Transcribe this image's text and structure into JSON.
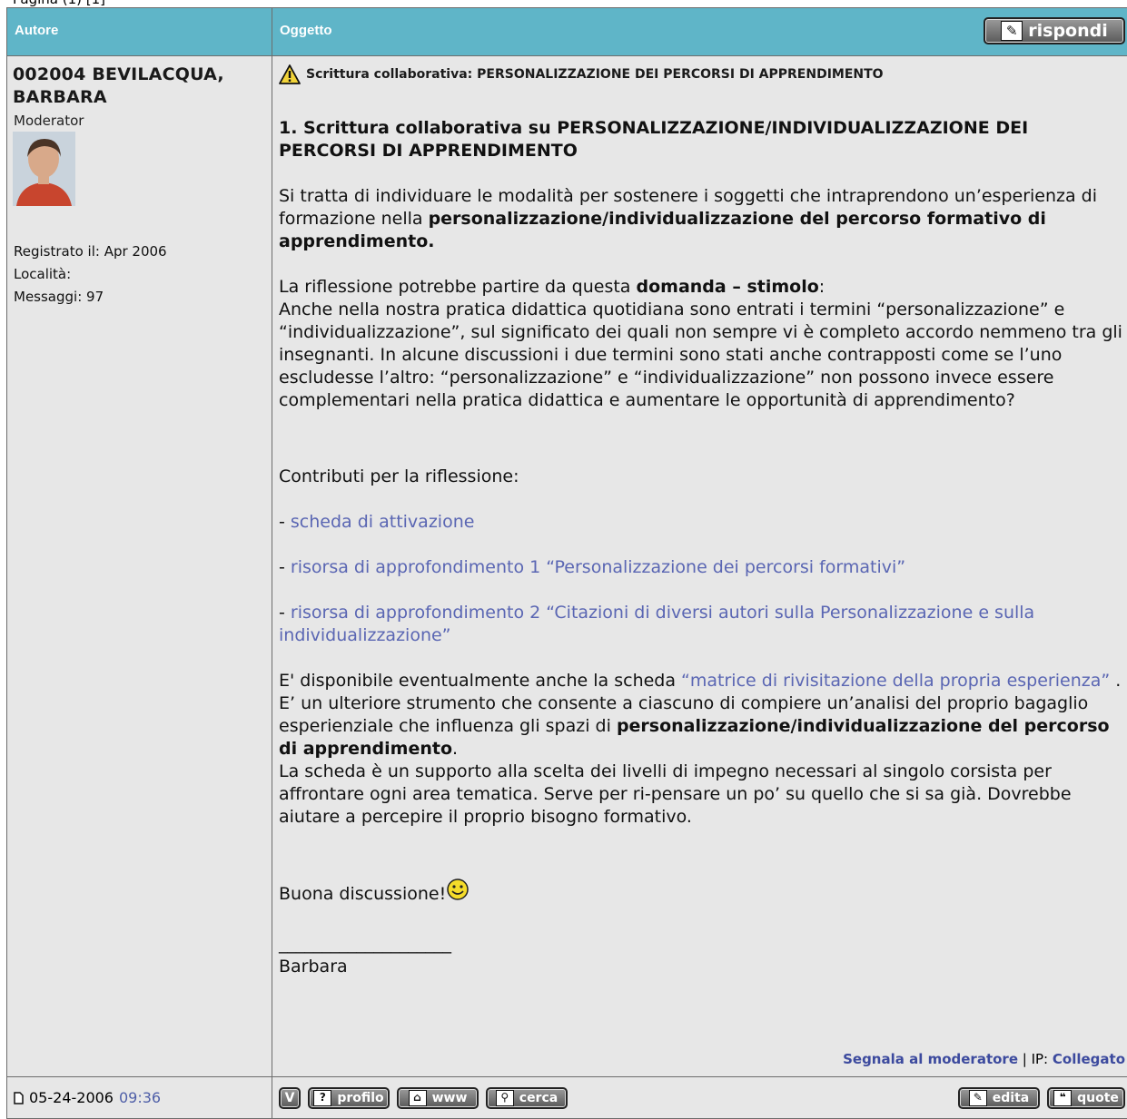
{
  "table": {
    "col_author": "Autore",
    "col_subject": "Oggetto",
    "reply_button": "rispondi"
  },
  "post": {
    "author_line1": "002004 BEVILACQUA,",
    "author_line2": "BARBARA",
    "role": "Moderator",
    "registered": "Registrato il: Apr 2006",
    "location": "Località:",
    "messages": "Messaggi: 97",
    "subject": "Scrittura collaborativa: PERSONALIZZAZIONE DEI PERCORSI DI APPRENDIMENTO",
    "title": "1. Scrittura collaborativa su PERSONALIZZAZIONE/INDIVIDUALIZZAZIONE DEI PERCORSI DI APPRENDIMENTO",
    "p1_text": "Si tratta di individuare le modalità per sostenere i soggetti che intraprendono un’esperienza di formazione nella ",
    "p1_bold": "personalizzazione/individualizzazione del percorso formativo di apprendimento.",
    "p2_text": "La riflessione potrebbe partire da questa ",
    "p2_bold": "domanda – stimolo",
    "p2_after": ":",
    "p3": "Anche nella nostra pratica didattica quotidiana sono entrati i termini “personalizzazione” e “individualizzazione”, sul significato dei quali non sempre vi è completo accordo nemmeno tra gli insegnanti. In alcune discussioni i due termini sono stati anche contrapposti come se l’uno escludesse l’altro: “personalizzazione” e “individualizzazione” non possono invece essere complementari nella pratica didattica e aumentare le opportunità di apprendimento?",
    "contrib_label": "Contributi per la riflessione:",
    "dash": "-",
    "link1": "scheda di attivazione",
    "link2": "risorsa di approfondimento 1 “Personalizzazione dei percorsi formativi”",
    "link3": "risorsa di approfondimento 2 “Citazioni di diversi autori sulla Personalizzazione e sulla individualizzazione”",
    "p4_text": "E' disponibile eventualmente anche la scheda ",
    "p4_link": "“matrice di rivisitazione della propria esperienza”",
    "p4_after": " .",
    "p5_text": "E’ un ulteriore strumento che consente a ciascuno di compiere un’analisi del proprio bagaglio esperienziale che influenza gli spazi di ",
    "p5_bold": "personalizzazione/individualizzazione del percorso di apprendimento",
    "p5_after": ".",
    "p6": "La scheda è un supporto alla scelta dei livelli di impegno necessari al singolo corsista per affrontare ogni area tematica. Serve per ri-pensare un po’ su quello che si sa già. Dovrebbe aiutare a percepire il proprio bisogno formativo.",
    "closing": "Buona discussione!",
    "signature_line": "____________________",
    "signature": "Barbara",
    "report_link": "Segnala al moderatore",
    "ip_sep": " | IP: ",
    "ip_value": "Collegato",
    "date": "05-24-2006",
    "time": "09:36"
  },
  "buttons": {
    "profile": "profilo",
    "www": "www",
    "search": "cerca",
    "edit": "edita",
    "quote": "quote",
    "v": "V"
  },
  "colors": {
    "header_bg": "#5fb5c8",
    "row_bg": "#e7e7e7",
    "link": "#5a66b3"
  }
}
